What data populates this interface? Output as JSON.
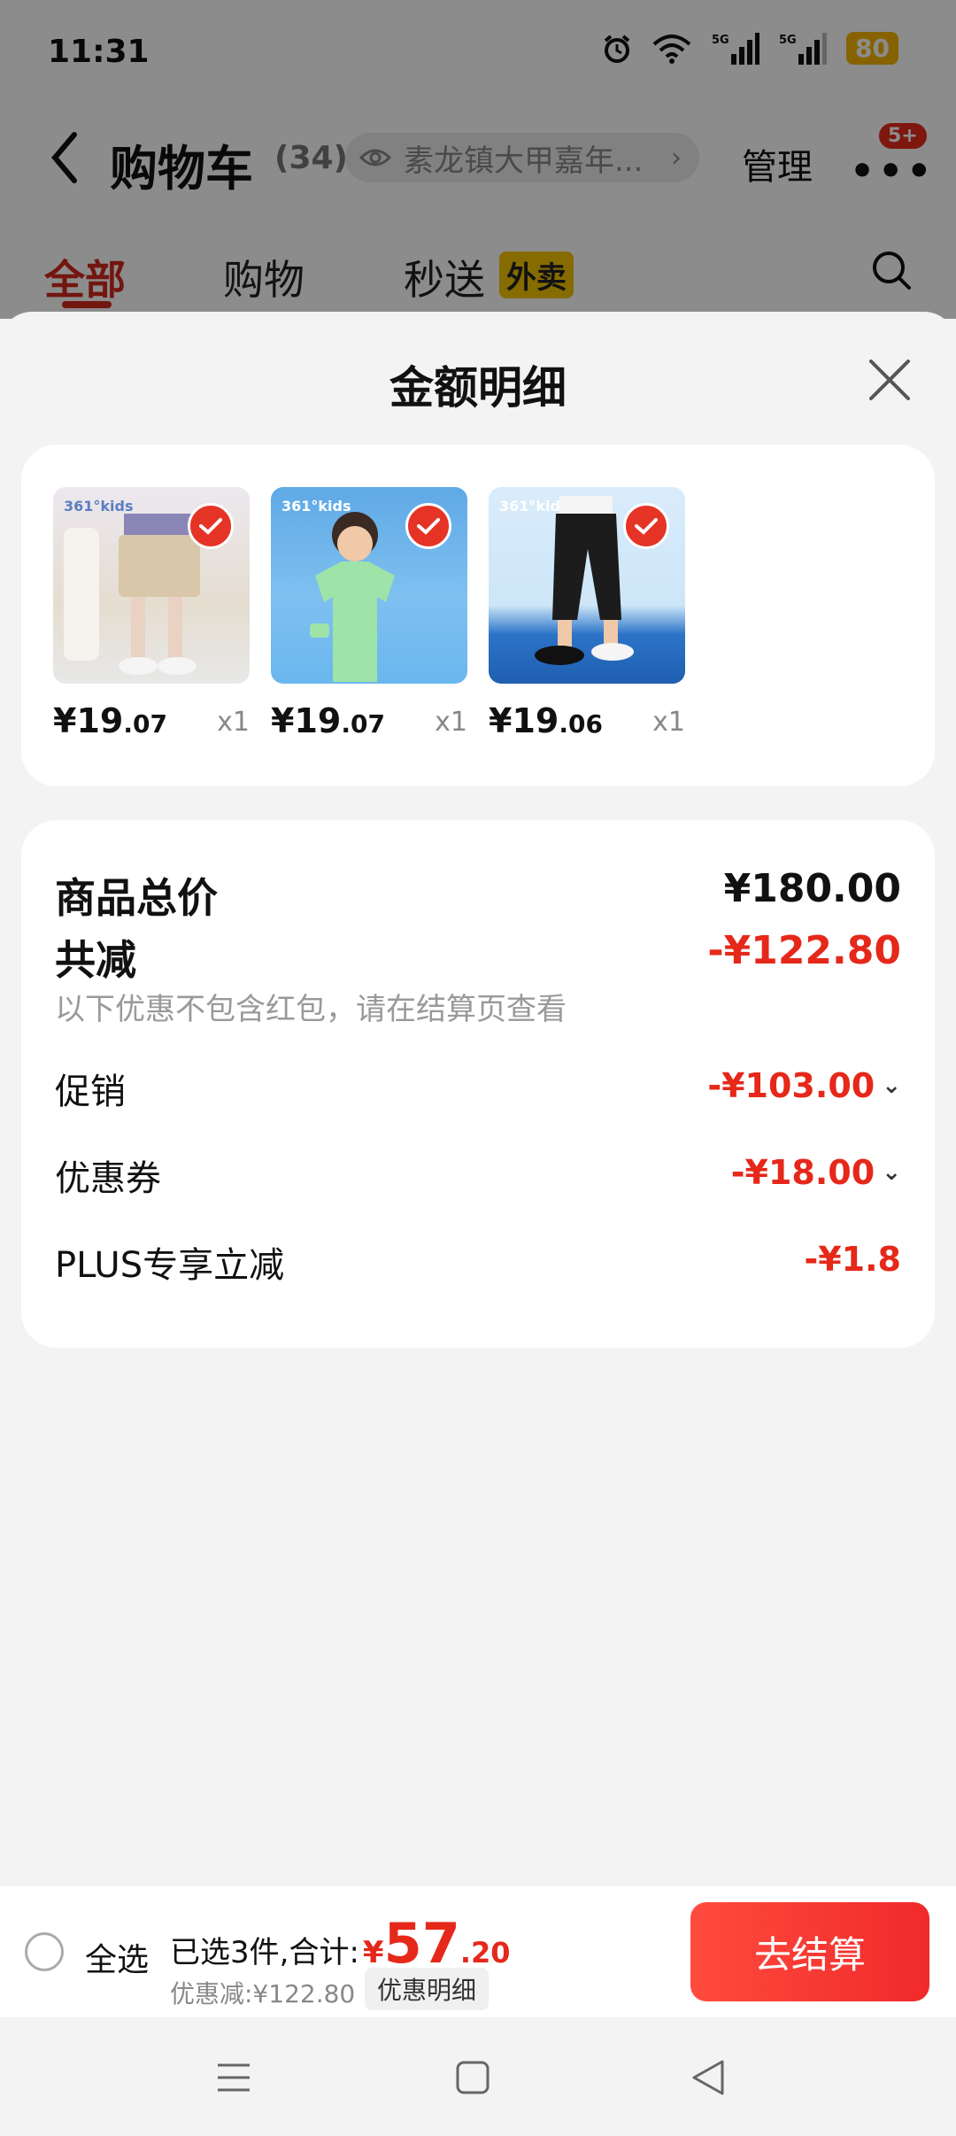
{
  "status_bar": {
    "time": "11:31",
    "battery": "80",
    "network_1": "5G",
    "network_2": "5G"
  },
  "header": {
    "title": "购物车",
    "count": "(34)",
    "address": "素龙镇大甲嘉年...",
    "manage": "管理",
    "badge": "5+"
  },
  "tabs": [
    {
      "label": "全部"
    },
    {
      "label": "购物"
    },
    {
      "label": "秒送"
    }
  ],
  "waimai_tag": "外卖",
  "sheet": {
    "title": "金额明细"
  },
  "products": [
    {
      "logo": "361°kids",
      "price_int": "¥19",
      "price_dec": ".07",
      "qty": "x1"
    },
    {
      "logo": "361°kids",
      "price_int": "¥19",
      "price_dec": ".07",
      "qty": "x1"
    },
    {
      "logo": "361°kids",
      "price_int": "¥19",
      "price_dec": ".06",
      "qty": "x1"
    }
  ],
  "summary": {
    "total_label": "商品总价",
    "total_value": "¥180.00",
    "reduce_label": "共减",
    "reduce_value": "-¥122.80",
    "hint": "以下优惠不包含红包，请在结算页查看",
    "promo_label": "促销",
    "promo_value": "-¥103.00",
    "coupon_label": "优惠券",
    "coupon_value": "-¥18.00",
    "plus_label": "PLUS专享立减",
    "plus_value": "-¥1.8"
  },
  "checkout": {
    "select_all": "全选",
    "selected_text": "已选3件,合计:",
    "yen": "¥",
    "total_int": "57",
    "total_dec": ".20",
    "discount": "优惠减:¥122.80",
    "detail_btn": "优惠明细",
    "checkout_btn": "去结算"
  },
  "colors": {
    "accent_red": "#e5281a",
    "waimai_yellow": "#f4c400"
  }
}
